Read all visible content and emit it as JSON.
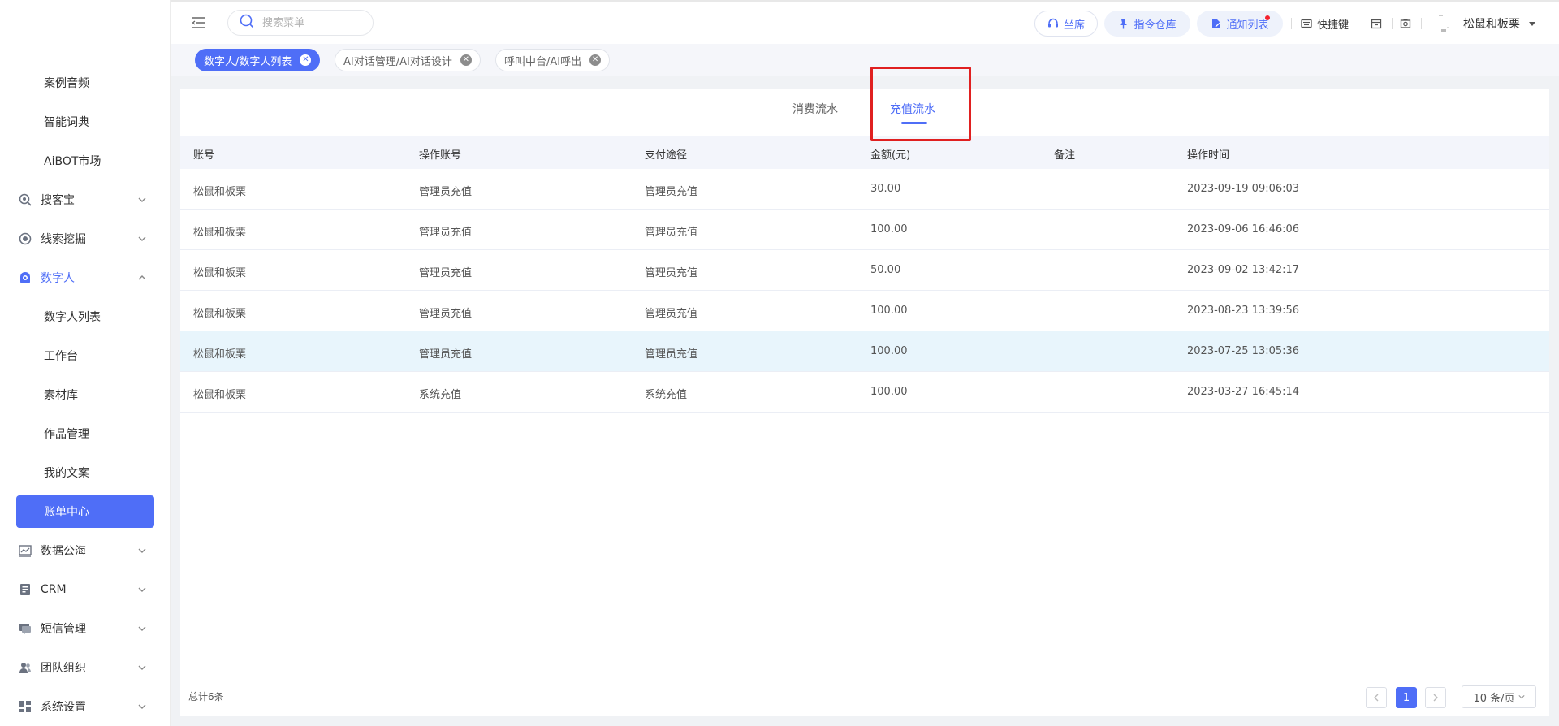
{
  "sidebar": {
    "items": [
      {
        "label": "案例音频"
      },
      {
        "label": "智能词典"
      },
      {
        "label": "AiBOT市场"
      },
      {
        "label": "搜客宝",
        "icon": "search-magnify-icon"
      },
      {
        "label": "线索挖掘",
        "icon": "target-icon"
      },
      {
        "label": "数字人",
        "icon": "robot-icon"
      },
      {
        "label": "数字人列表"
      },
      {
        "label": "工作台"
      },
      {
        "label": "素材库"
      },
      {
        "label": "作品管理"
      },
      {
        "label": "我的文案"
      },
      {
        "label": "账单中心"
      },
      {
        "label": "数据公海",
        "icon": "chart-icon"
      },
      {
        "label": "CRM",
        "icon": "crm-icon"
      },
      {
        "label": "短信管理",
        "icon": "message-icon"
      },
      {
        "label": "团队组织",
        "icon": "team-icon"
      },
      {
        "label": "系统设置",
        "icon": "settings-grid-icon"
      }
    ]
  },
  "header": {
    "search_placeholder": "搜索菜单",
    "seat_label": "坐席",
    "command_label": "指令仓库",
    "notify_label": "通知列表",
    "shortcut_label": "快捷键",
    "user_name": "松鼠和板栗"
  },
  "tags": [
    {
      "label": "数字人/数字人列表"
    },
    {
      "label": "AI对话管理/AI对话设计"
    },
    {
      "label": "呼叫中台/AI呼出"
    }
  ],
  "tabs": [
    {
      "label": "消费流水"
    },
    {
      "label": "充值流水"
    }
  ],
  "table": {
    "headers": [
      "账号",
      "操作账号",
      "支付途径",
      "金额(元)",
      "备注",
      "操作时间"
    ],
    "rows": [
      [
        "松鼠和板栗",
        "管理员充值",
        "管理员充值",
        "30.00",
        "",
        "2023-09-19 09:06:03"
      ],
      [
        "松鼠和板栗",
        "管理员充值",
        "管理员充值",
        "100.00",
        "",
        "2023-09-06 16:46:06"
      ],
      [
        "松鼠和板栗",
        "管理员充值",
        "管理员充值",
        "50.00",
        "",
        "2023-09-02 13:42:17"
      ],
      [
        "松鼠和板栗",
        "管理员充值",
        "管理员充值",
        "100.00",
        "",
        "2023-08-23 13:39:56"
      ],
      [
        "松鼠和板栗",
        "管理员充值",
        "管理员充值",
        "100.00",
        "",
        "2023-07-25 13:05:36"
      ],
      [
        "松鼠和板栗",
        "系统充值",
        "系统充值",
        "100.00",
        "",
        "2023-03-27 16:45:14"
      ]
    ]
  },
  "pagination": {
    "total": "总计6条",
    "current": "1",
    "page_size": "10 条/页"
  },
  "colors": {
    "accent": "#4f6ef7",
    "highlight_row": "#e8f5fc",
    "annotation": "#e02020"
  }
}
